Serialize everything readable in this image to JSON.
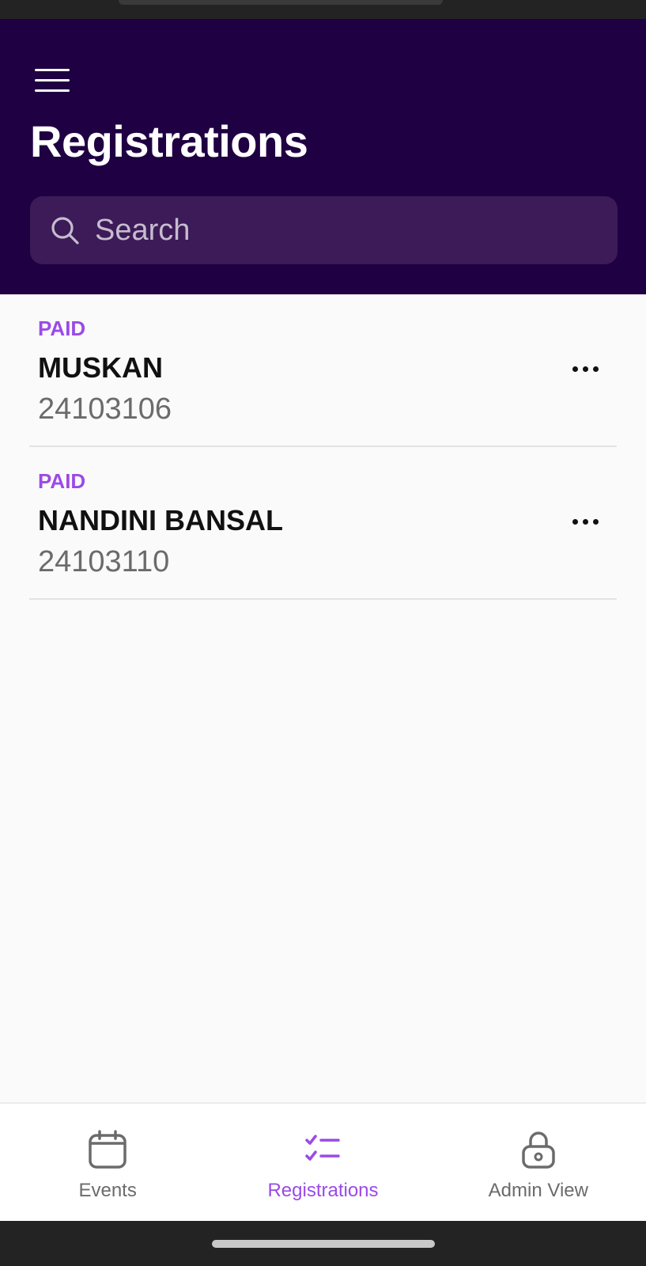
{
  "header": {
    "title": "Registrations",
    "search": {
      "placeholder": "Search",
      "value": ""
    }
  },
  "registrations": [
    {
      "status": "PAID",
      "name": "MUSKAN",
      "id": "24103106"
    },
    {
      "status": "PAID",
      "name": "NANDINI BANSAL",
      "id": "24103110"
    }
  ],
  "bottom_nav": {
    "tabs": [
      {
        "label": "Events",
        "icon": "calendar-icon",
        "active": false
      },
      {
        "label": "Registrations",
        "icon": "checklist-icon",
        "active": true
      },
      {
        "label": "Admin View",
        "icon": "lock-icon",
        "active": false
      }
    ]
  },
  "colors": {
    "header_bg": "#1f0042",
    "search_bg": "#3c1b58",
    "accent": "#9b4ae6",
    "page_bg": "#fafafa"
  }
}
